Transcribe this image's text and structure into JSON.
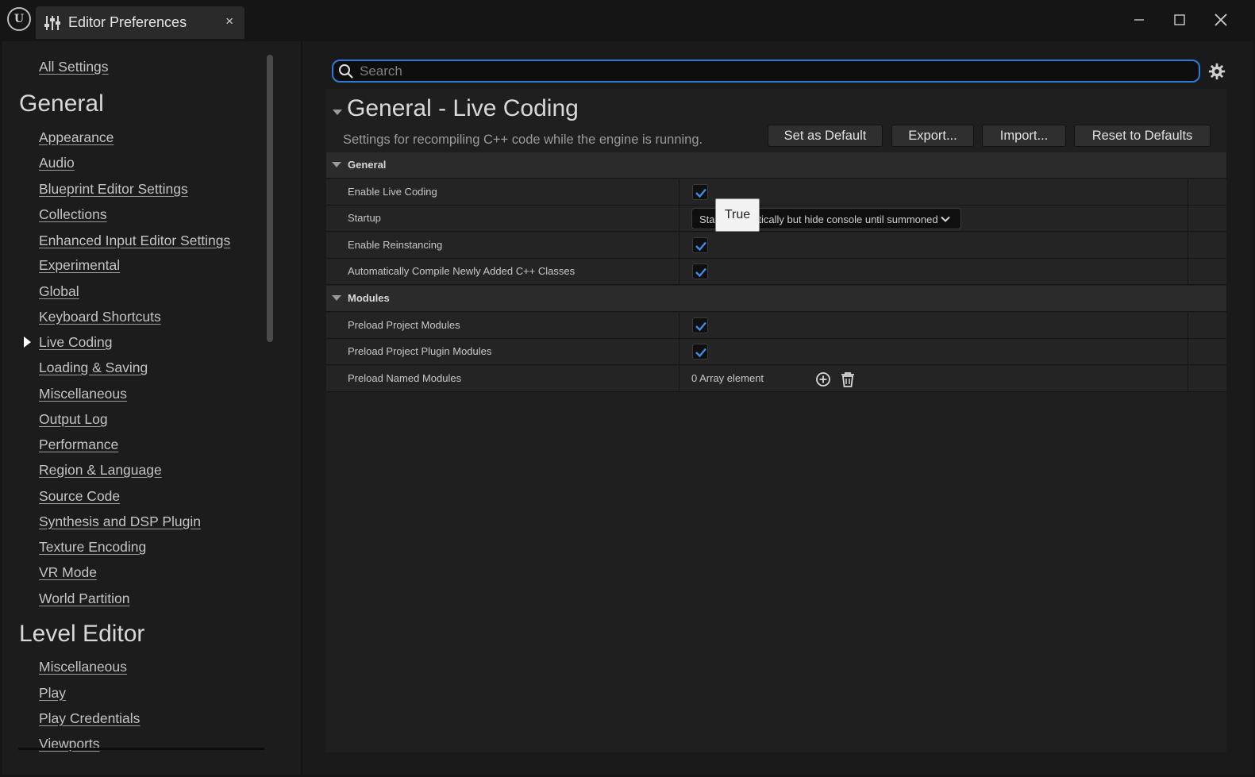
{
  "titlebar": {
    "logo_glyph": "U",
    "tab_title": "Editor Preferences",
    "tab_close": "×"
  },
  "sidebar": {
    "all_settings": "All Settings",
    "groups": [
      {
        "heading": "General",
        "items": [
          "Appearance",
          "Audio",
          "Blueprint Editor Settings",
          "Collections",
          "Enhanced Input Editor Settings",
          "Experimental",
          "Global",
          "Keyboard Shortcuts",
          "Live Coding",
          "Loading & Saving",
          "Miscellaneous",
          "Output Log",
          "Performance",
          "Region & Language",
          "Source Code",
          "Synthesis and DSP Plugin",
          "Texture Encoding",
          "VR Mode",
          "World Partition"
        ],
        "selected": "Live Coding"
      },
      {
        "heading": "Level Editor",
        "items": [
          "Miscellaneous",
          "Play",
          "Play Credentials",
          "Viewports"
        ]
      }
    ]
  },
  "search": {
    "placeholder": "Search",
    "value": ""
  },
  "section": {
    "title": "General - Live Coding",
    "description": "Settings for recompiling C++ code while the engine is running.",
    "buttons": [
      "Set as Default",
      "Export...",
      "Import...",
      "Reset to Defaults"
    ]
  },
  "categories": {
    "general": {
      "label": "General",
      "props": {
        "enable_live_coding": {
          "name": "Enable Live Coding",
          "checked": true
        },
        "startup": {
          "name": "Startup",
          "value": "Start automatically but hide console until summoned"
        },
        "enable_reinstancing": {
          "name": "Enable Reinstancing",
          "checked": true
        },
        "auto_compile": {
          "name": "Automatically Compile Newly Added C++ Classes",
          "checked": true
        }
      }
    },
    "modules": {
      "label": "Modules",
      "props": {
        "preload_project": {
          "name": "Preload Project Modules",
          "checked": true
        },
        "preload_plugin": {
          "name": "Preload Project Plugin Modules",
          "checked": true
        },
        "preload_named": {
          "name": "Preload Named Modules",
          "value": "0 Array element"
        }
      }
    }
  },
  "tooltip": {
    "text": "True"
  },
  "colors": {
    "accent": "#2e7ad6",
    "check": "#3b8be8",
    "background": "#151515"
  },
  "icons": [
    "unreal-logo",
    "sliders-icon",
    "minimize-icon",
    "maximize-icon",
    "close-icon",
    "search-icon",
    "gear-icon",
    "checkmark-icon",
    "chevron-down-icon",
    "add-circle-icon",
    "trash-icon"
  ]
}
